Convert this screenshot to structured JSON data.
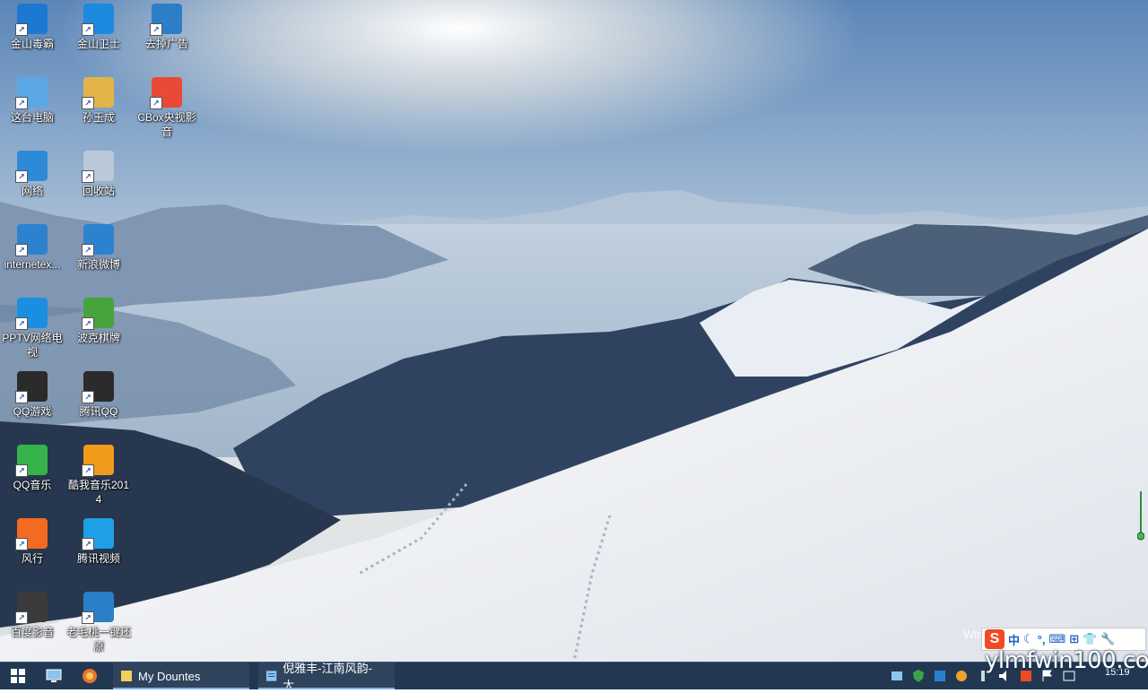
{
  "desktop": {
    "icons": [
      {
        "label": "金山毒霸",
        "color": "#1d78d2",
        "symbol": "shield-arrow-icon"
      },
      {
        "label": "金山卫士",
        "color": "#1d8ae0",
        "symbol": "shield-icon"
      },
      {
        "label": "去掉广告",
        "color": "#2c7ec6",
        "symbol": "program-icon"
      },
      {
        "label": "这台电脑",
        "color": "#5ba8e6",
        "symbol": "computer-icon"
      },
      {
        "label": "孙玉成",
        "color": "#e2b44a",
        "symbol": "user-folder-icon"
      },
      {
        "label": "CBox央视影音",
        "color": "#e94a37",
        "symbol": "cbox-icon"
      },
      {
        "label": "网络",
        "color": "#2d8ad6",
        "symbol": "network-icon"
      },
      {
        "label": "回收站",
        "color": "#b9c9d8",
        "symbol": "recycle-bin-icon"
      },
      {
        "label": "internetex...",
        "color": "#2d82d0",
        "symbol": "ie-icon"
      },
      {
        "label": "新浪微博",
        "color": "#2d82d0",
        "symbol": "ie-icon"
      },
      {
        "label": "PPTV网络电视",
        "color": "#1a8fe0",
        "symbol": "pptv-icon"
      },
      {
        "label": "波克棋牌",
        "color": "#47a43c",
        "symbol": "game-icon"
      },
      {
        "label": "QQ游戏",
        "color": "#2b2b2b",
        "symbol": "qq-penguin-icon"
      },
      {
        "label": "腾讯QQ",
        "color": "#2b2b2b",
        "symbol": "qq-penguin-icon"
      },
      {
        "label": "QQ音乐",
        "color": "#35b34a",
        "symbol": "music-icon"
      },
      {
        "label": "酷我音乐2014",
        "color": "#f29a1c",
        "symbol": "kuwo-icon"
      },
      {
        "label": "风行",
        "color": "#f26b21",
        "symbol": "funshion-icon"
      },
      {
        "label": "腾讯视频",
        "color": "#1fa0e6",
        "symbol": "video-play-icon"
      },
      {
        "label": "百度影音",
        "color": "#3b3b3b",
        "symbol": "film-reel-icon"
      },
      {
        "label": "老毛桃一键还原",
        "color": "#2a7fc8",
        "symbol": "restore-icon"
      }
    ]
  },
  "taskbar": {
    "start_label": "Start",
    "tasks": [
      {
        "label": "My Dountes",
        "icon": "folder-icon"
      },
      {
        "label": "倪雅丰-江南风韵-太...",
        "icon": "document-icon"
      }
    ],
    "clock": "15:19"
  },
  "ime": {
    "logo": "S",
    "mode": "中",
    "items": [
      "☾",
      "°,",
      "⌨",
      "⊞",
      "👕",
      "🔧"
    ]
  },
  "watermark": "ylmfwin100.com",
  "activation_text": "Win"
}
